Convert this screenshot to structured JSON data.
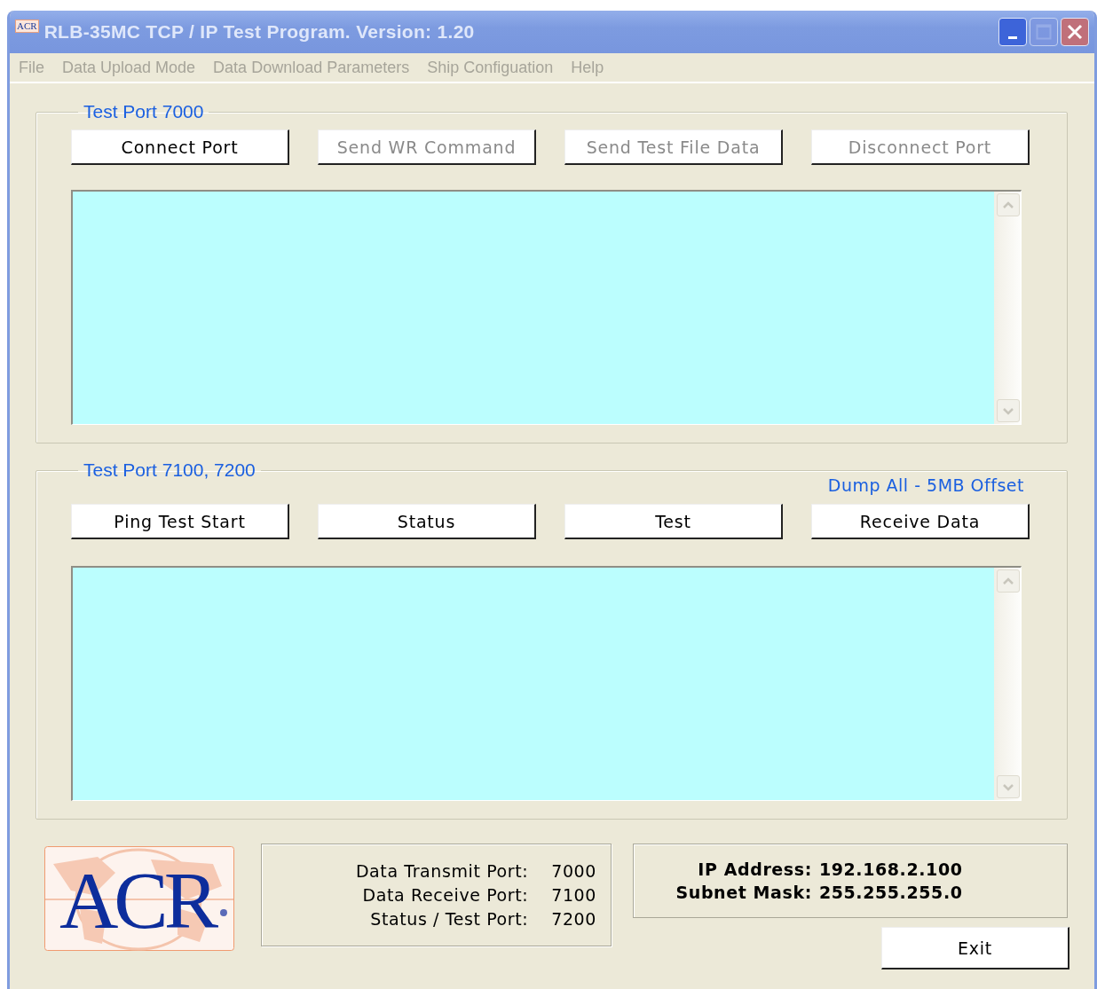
{
  "window": {
    "title": "RLB-35MC TCP / IP Test Program. Version: 1.20",
    "app_icon_text": "ACR",
    "controls": [
      {
        "kind": "minimize",
        "disabled": false
      },
      {
        "kind": "maximize",
        "disabled": true
      },
      {
        "kind": "close",
        "disabled": false
      }
    ]
  },
  "menu": [
    {
      "label": "File",
      "disabled": true
    },
    {
      "label": "Data Upload Mode",
      "disabled": true
    },
    {
      "label": "Data Download Parameters",
      "disabled": true
    },
    {
      "label": "Ship Configuation",
      "disabled": true
    },
    {
      "label": "Help",
      "disabled": true
    }
  ],
  "groups": [
    {
      "legend": "Test Port 7000",
      "buttons": [
        {
          "label": "Connect Port",
          "disabled": false
        },
        {
          "label": "Send WR Command",
          "disabled": true
        },
        {
          "label": "Send Test File Data",
          "disabled": true
        },
        {
          "label": "Disconnect Port",
          "disabled": true
        }
      ]
    },
    {
      "legend": "Test Port 7100, 7200",
      "note": "Dump All - 5MB Offset",
      "buttons": [
        {
          "label": "Ping Test Start",
          "disabled": false
        },
        {
          "label": "Status",
          "disabled": false
        },
        {
          "label": "Test",
          "disabled": false
        },
        {
          "label": "Receive Data",
          "disabled": false
        }
      ]
    }
  ],
  "logo": {
    "text": "ACR"
  },
  "ports": [
    {
      "label": "Data Transmit Port:",
      "value": "7000"
    },
    {
      "label": "Data Receive Port:",
      "value": "7100"
    },
    {
      "label": "Status / Test Port:",
      "value": "7200"
    }
  ],
  "network": [
    {
      "label": "IP Address:",
      "value": "192.168.2.100"
    },
    {
      "label": "Subnet Mask:",
      "value": "255.255.255.0"
    }
  ],
  "exit_button": {
    "label": "Exit"
  }
}
